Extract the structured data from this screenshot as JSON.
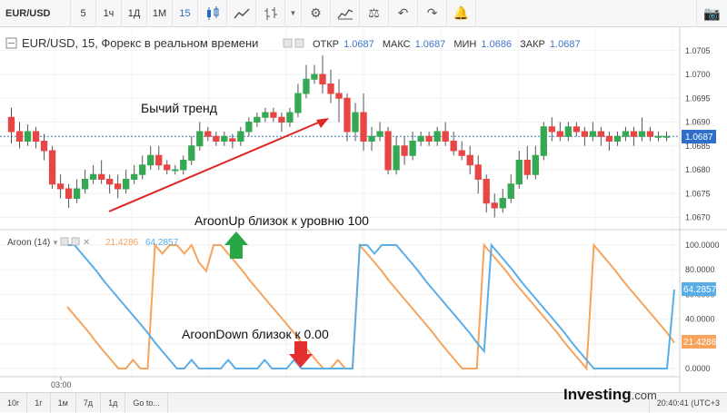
{
  "toolbar": {
    "symbol": "EUR/USD",
    "intervals": [
      "5",
      "1ч",
      "1Д",
      "1М",
      "15"
    ],
    "active_interval": "15"
  },
  "header": {
    "title": "EUR/USD, 15, Форекс в реальном времени",
    "ohlc": [
      {
        "label": "ОТКР",
        "value": "1.0687"
      },
      {
        "label": "МАКС",
        "value": "1.0687"
      },
      {
        "label": "МИН",
        "value": "1.0686"
      },
      {
        "label": "ЗАКР",
        "value": "1.0687"
      }
    ]
  },
  "annotations": {
    "bull": "Бычий тренд",
    "aroon_up": "AroonUp близок к уровню 100",
    "aroon_down": "AroonDown близок к 0.00"
  },
  "indicator": {
    "name": "Aroon (14)",
    "down_value": "21.4286",
    "up_value": "64.2857",
    "down_color": "#f7a35c",
    "up_color": "#5aaee8"
  },
  "bottom": {
    "ranges": [
      "10г",
      "1г",
      "1м",
      "7д",
      "1д",
      "Go to..."
    ],
    "time": "20:40:41 (UTC+3"
  },
  "logo": {
    "brand": "Investing",
    "suffix": ".com"
  },
  "colors": {
    "up": "#34a853",
    "down": "#e84545",
    "arrow_up": "#29a745",
    "arrow_down": "#e52e2e",
    "trend": "#e02525"
  },
  "chart_data": [
    {
      "type": "candlestick",
      "price_axis_ticks": [
        "1.0705",
        "1.0700",
        "1.0695",
        "1.0690",
        "1.0685",
        "1.0680",
        "1.0675",
        "1.0670"
      ],
      "ylim": [
        1.0668,
        1.0708
      ],
      "current_price": "1.0687",
      "time_axis_label": "03:00",
      "candles": [
        {
          "o": 1.0691,
          "c": 1.0688,
          "h": 1.0693,
          "l": 1.06855
        },
        {
          "o": 1.0688,
          "c": 1.0686,
          "h": 1.069,
          "l": 1.06845
        },
        {
          "o": 1.0686,
          "c": 1.0688,
          "h": 1.06895,
          "l": 1.0685
        },
        {
          "o": 1.0688,
          "c": 1.0686,
          "h": 1.0689,
          "l": 1.06845
        },
        {
          "o": 1.0686,
          "c": 1.0684,
          "h": 1.06875,
          "l": 1.0682
        },
        {
          "o": 1.0684,
          "c": 1.0677,
          "h": 1.0685,
          "l": 1.0676
        },
        {
          "o": 1.0677,
          "c": 1.0676,
          "h": 1.0679,
          "l": 1.0674
        },
        {
          "o": 1.0676,
          "c": 1.0674,
          "h": 1.0677,
          "l": 1.0672
        },
        {
          "o": 1.0674,
          "c": 1.0676,
          "h": 1.0678,
          "l": 1.0673
        },
        {
          "o": 1.0676,
          "c": 1.0678,
          "h": 1.068,
          "l": 1.0675
        },
        {
          "o": 1.0678,
          "c": 1.0679,
          "h": 1.0681,
          "l": 1.0677
        },
        {
          "o": 1.0679,
          "c": 1.0678,
          "h": 1.0682,
          "l": 1.0677
        },
        {
          "o": 1.0678,
          "c": 1.0677,
          "h": 1.0679,
          "l": 1.0675
        },
        {
          "o": 1.0677,
          "c": 1.0676,
          "h": 1.0679,
          "l": 1.0674
        },
        {
          "o": 1.0676,
          "c": 1.0678,
          "h": 1.068,
          "l": 1.0675
        },
        {
          "o": 1.0678,
          "c": 1.0679,
          "h": 1.0681,
          "l": 1.0677
        },
        {
          "o": 1.0679,
          "c": 1.0681,
          "h": 1.0683,
          "l": 1.0678
        },
        {
          "o": 1.0681,
          "c": 1.0683,
          "h": 1.0685,
          "l": 1.068
        },
        {
          "o": 1.0683,
          "c": 1.0681,
          "h": 1.0685,
          "l": 1.068
        },
        {
          "o": 1.0681,
          "c": 1.068,
          "h": 1.0682,
          "l": 1.0679
        },
        {
          "o": 1.068,
          "c": 1.068,
          "h": 1.0681,
          "l": 1.0679
        },
        {
          "o": 1.068,
          "c": 1.0682,
          "h": 1.0683,
          "l": 1.0679
        },
        {
          "o": 1.0682,
          "c": 1.0685,
          "h": 1.0687,
          "l": 1.0681
        },
        {
          "o": 1.0685,
          "c": 1.0688,
          "h": 1.069,
          "l": 1.0684
        },
        {
          "o": 1.0688,
          "c": 1.0687,
          "h": 1.0689,
          "l": 1.0686
        },
        {
          "o": 1.0687,
          "c": 1.0686,
          "h": 1.0688,
          "l": 1.0685
        },
        {
          "o": 1.0686,
          "c": 1.0687,
          "h": 1.0688,
          "l": 1.0685
        },
        {
          "o": 1.06865,
          "c": 1.0686,
          "h": 1.06875,
          "l": 1.06845
        },
        {
          "o": 1.0686,
          "c": 1.0688,
          "h": 1.0689,
          "l": 1.0685
        },
        {
          "o": 1.0688,
          "c": 1.069,
          "h": 1.0691,
          "l": 1.0687
        },
        {
          "o": 1.069,
          "c": 1.0691,
          "h": 1.0692,
          "l": 1.0689
        },
        {
          "o": 1.0691,
          "c": 1.0692,
          "h": 1.0693,
          "l": 1.069
        },
        {
          "o": 1.0692,
          "c": 1.0691,
          "h": 1.0693,
          "l": 1.069
        },
        {
          "o": 1.0691,
          "c": 1.069,
          "h": 1.0692,
          "l": 1.0688
        },
        {
          "o": 1.069,
          "c": 1.0692,
          "h": 1.0693,
          "l": 1.0689
        },
        {
          "o": 1.0692,
          "c": 1.0696,
          "h": 1.0698,
          "l": 1.0691
        },
        {
          "o": 1.0696,
          "c": 1.0699,
          "h": 1.0702,
          "l": 1.0695
        },
        {
          "o": 1.0699,
          "c": 1.07,
          "h": 1.0702,
          "l": 1.0698
        },
        {
          "o": 1.07,
          "c": 1.0698,
          "h": 1.0704,
          "l": 1.0696
        },
        {
          "o": 1.0698,
          "c": 1.0696,
          "h": 1.0701,
          "l": 1.0694
        },
        {
          "o": 1.0696,
          "c": 1.0695,
          "h": 1.0699,
          "l": 1.069
        },
        {
          "o": 1.0695,
          "c": 1.0688,
          "h": 1.0696,
          "l": 1.0686
        },
        {
          "o": 1.0688,
          "c": 1.0692,
          "h": 1.0694,
          "l": 1.0686
        },
        {
          "o": 1.0692,
          "c": 1.0686,
          "h": 1.0696,
          "l": 1.0684
        },
        {
          "o": 1.0686,
          "c": 1.0687,
          "h": 1.0689,
          "l": 1.0684
        },
        {
          "o": 1.0687,
          "c": 1.0688,
          "h": 1.069,
          "l": 1.0686
        },
        {
          "o": 1.0688,
          "c": 1.068,
          "h": 1.0689,
          "l": 1.0679
        },
        {
          "o": 1.068,
          "c": 1.0685,
          "h": 1.0687,
          "l": 1.0679
        },
        {
          "o": 1.0685,
          "c": 1.0683,
          "h": 1.0687,
          "l": 1.0681
        },
        {
          "o": 1.0683,
          "c": 1.0686,
          "h": 1.0688,
          "l": 1.0682
        },
        {
          "o": 1.0686,
          "c": 1.0687,
          "h": 1.0688,
          "l": 1.0685
        },
        {
          "o": 1.0687,
          "c": 1.0686,
          "h": 1.0688,
          "l": 1.0685
        },
        {
          "o": 1.0686,
          "c": 1.0688,
          "h": 1.0689,
          "l": 1.0685
        },
        {
          "o": 1.0688,
          "c": 1.0686,
          "h": 1.069,
          "l": 1.0685
        },
        {
          "o": 1.0686,
          "c": 1.0684,
          "h": 1.0688,
          "l": 1.0683
        },
        {
          "o": 1.0684,
          "c": 1.0683,
          "h": 1.0686,
          "l": 1.0682
        },
        {
          "o": 1.0683,
          "c": 1.0681,
          "h": 1.0685,
          "l": 1.0679
        },
        {
          "o": 1.0681,
          "c": 1.0678,
          "h": 1.0683,
          "l": 1.0675
        },
        {
          "o": 1.0678,
          "c": 1.0673,
          "h": 1.0679,
          "l": 1.0671
        },
        {
          "o": 1.0673,
          "c": 1.0672,
          "h": 1.0675,
          "l": 1.067
        },
        {
          "o": 1.0672,
          "c": 1.0674,
          "h": 1.0676,
          "l": 1.0671
        },
        {
          "o": 1.0674,
          "c": 1.0677,
          "h": 1.0679,
          "l": 1.0673
        },
        {
          "o": 1.0677,
          "c": 1.0682,
          "h": 1.0684,
          "l": 1.0676
        },
        {
          "o": 1.0682,
          "c": 1.0679,
          "h": 1.0685,
          "l": 1.0678
        },
        {
          "o": 1.0679,
          "c": 1.0683,
          "h": 1.0685,
          "l": 1.0678
        },
        {
          "o": 1.0683,
          "c": 1.0689,
          "h": 1.069,
          "l": 1.0682
        },
        {
          "o": 1.0689,
          "c": 1.0688,
          "h": 1.0691,
          "l": 1.0686
        },
        {
          "o": 1.0688,
          "c": 1.0687,
          "h": 1.069,
          "l": 1.0686
        },
        {
          "o": 1.0687,
          "c": 1.0689,
          "h": 1.069,
          "l": 1.0686
        },
        {
          "o": 1.0689,
          "c": 1.0688,
          "h": 1.069,
          "l": 1.0687
        },
        {
          "o": 1.0688,
          "c": 1.0687,
          "h": 1.0689,
          "l": 1.0685
        },
        {
          "o": 1.0687,
          "c": 1.0688,
          "h": 1.069,
          "l": 1.0686
        },
        {
          "o": 1.0688,
          "c": 1.0687,
          "h": 1.0689,
          "l": 1.0685
        },
        {
          "o": 1.0687,
          "c": 1.0686,
          "h": 1.0688,
          "l": 1.0684
        },
        {
          "o": 1.0686,
          "c": 1.0687,
          "h": 1.0688,
          "l": 1.0685
        },
        {
          "o": 1.0687,
          "c": 1.0688,
          "h": 1.0689,
          "l": 1.0686
        },
        {
          "o": 1.0688,
          "c": 1.0687,
          "h": 1.0689,
          "l": 1.0685
        },
        {
          "o": 1.0687,
          "c": 1.0688,
          "h": 1.0691,
          "l": 1.0686
        },
        {
          "o": 1.0688,
          "c": 1.0687,
          "h": 1.0689,
          "l": 1.0686
        },
        {
          "o": 1.0687,
          "c": 1.0687,
          "h": 1.0688,
          "l": 1.0686
        },
        {
          "o": 1.0687,
          "c": 1.0687,
          "h": 1.0688,
          "l": 1.0686
        }
      ]
    },
    {
      "type": "line",
      "title": "Aroon (14)",
      "ylim": [
        0,
        100
      ],
      "y_ticks": [
        "100.0000",
        "80.0000",
        "60.0000",
        "40.0000",
        "20.0000",
        "0.0000"
      ],
      "series": [
        {
          "name": "21.4286",
          "values": [
            50,
            43,
            36,
            29,
            21,
            14,
            7,
            0,
            0,
            7,
            0,
            0,
            100,
            93,
            100,
            100,
            93,
            100,
            86,
            79,
            100,
            100,
            93,
            86,
            79,
            71,
            64,
            57,
            50,
            43,
            36,
            29,
            21,
            14,
            7,
            0,
            0,
            7,
            0,
            0,
            100,
            93,
            86,
            79,
            71,
            64,
            57,
            50,
            43,
            36,
            29,
            21,
            14,
            7,
            0,
            0,
            0,
            100,
            93,
            86,
            79,
            71,
            64,
            57,
            50,
            43,
            36,
            29,
            21,
            14,
            7,
            0,
            100,
            93,
            86,
            79,
            71,
            64,
            57,
            50,
            43,
            36,
            29,
            21
          ]
        },
        {
          "name": "64.2857",
          "values": [
            100,
            100,
            93,
            86,
            79,
            71,
            64,
            57,
            50,
            43,
            36,
            29,
            21,
            14,
            7,
            0,
            0,
            7,
            0,
            0,
            0,
            0,
            7,
            0,
            0,
            0,
            0,
            7,
            0,
            0,
            0,
            7,
            0,
            0,
            0,
            0,
            0,
            0,
            0,
            0,
            100,
            100,
            93,
            100,
            100,
            100,
            93,
            86,
            79,
            71,
            64,
            57,
            50,
            43,
            36,
            29,
            21,
            14,
            100,
            93,
            86,
            79,
            71,
            64,
            57,
            50,
            43,
            36,
            29,
            21,
            14,
            7,
            0,
            0,
            0,
            0,
            0,
            0,
            0,
            0,
            0,
            0,
            0,
            64
          ]
        }
      ]
    }
  ]
}
